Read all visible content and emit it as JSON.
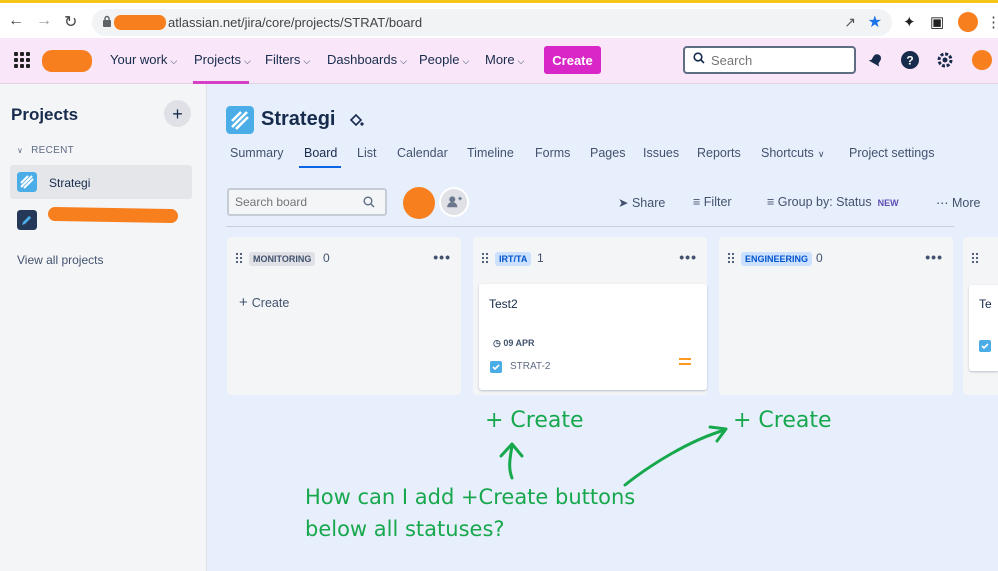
{
  "browser": {
    "url_text": "atlassian.net/jira/core/projects/STRAT/board"
  },
  "topnav": {
    "items": [
      {
        "label": "Your work"
      },
      {
        "label": "Projects"
      },
      {
        "label": "Filters"
      },
      {
        "label": "Dashboards"
      },
      {
        "label": "People"
      },
      {
        "label": "More"
      }
    ],
    "create_label": "Create",
    "search_placeholder": "Search",
    "accent_color": "#d926c6"
  },
  "sidebar": {
    "title": "Projects",
    "recent_label": "RECENT",
    "items": [
      {
        "label": "Strategi",
        "active": true
      }
    ],
    "view_all_label": "View all projects"
  },
  "project": {
    "name": "Strategi",
    "tabs": [
      "Summary",
      "Board",
      "List",
      "Calendar",
      "Timeline",
      "Forms",
      "Pages",
      "Issues",
      "Reports",
      "Shortcuts",
      "Project settings"
    ],
    "active_tab": "Board"
  },
  "toolbar": {
    "search_placeholder": "Search board",
    "share_label": "Share",
    "filter_label": "Filter",
    "group_by_label": "Group by: Status",
    "new_badge": "NEW",
    "more_label": "More"
  },
  "columns": [
    {
      "status": "MONITORING",
      "count": "0",
      "create_label": "Create"
    },
    {
      "status": "IRT/TA",
      "count": "1",
      "cards": [
        {
          "title": "Test2",
          "date": "09 APR",
          "key": "STRAT-2"
        }
      ]
    },
    {
      "status": "ENGINEERING",
      "count": "0"
    }
  ],
  "partial_card_text": "Te",
  "annotations": {
    "create_1": "+ Create",
    "create_2": "+ Create",
    "question_line1": "How can I add +Create buttons",
    "question_line2": "below all statuses?"
  }
}
